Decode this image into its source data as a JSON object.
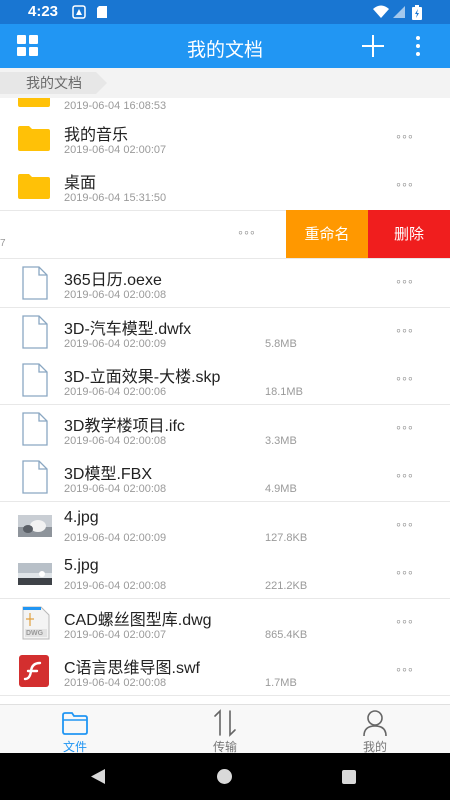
{
  "status_bar": {
    "time": "4:23",
    "icons": [
      "notification-icon",
      "sd-card-icon",
      "wifi-icon",
      "signal-icon",
      "battery-icon"
    ]
  },
  "app_bar": {
    "title": "我的文档",
    "icons": [
      "grid-menu-icon",
      "add-icon",
      "more-vert-icon"
    ]
  },
  "breadcrumb": {
    "label": "我的文档"
  },
  "partial_row": {
    "date": "2019-06-04 16:08:53"
  },
  "files": [
    {
      "type": "folder",
      "name": "我的音乐",
      "date": "2019-06-04 02:00:07",
      "size": ""
    },
    {
      "type": "folder",
      "name": "桌面",
      "date": "2019-06-04 15:31:50",
      "size": ""
    },
    {
      "type": "doc",
      "name": "365日历.oexe",
      "date": "2019-06-04 02:00:08",
      "size": ""
    },
    {
      "type": "doc",
      "name": "3D-汽车模型.dwfx",
      "date": "2019-06-04 02:00:09",
      "size": "5.8MB"
    },
    {
      "type": "doc",
      "name": "3D-立面效果-大楼.skp",
      "date": "2019-06-04 02:00:06",
      "size": "18.1MB"
    },
    {
      "type": "doc",
      "name": "3D教学楼项目.ifc",
      "date": "2019-06-04 02:00:08",
      "size": "3.3MB"
    },
    {
      "type": "doc",
      "name": "3D模型.FBX",
      "date": "2019-06-04 02:00:08",
      "size": "4.9MB"
    },
    {
      "type": "image",
      "name": "4.jpg",
      "date": "2019-06-04 02:00:09",
      "size": "127.8KB"
    },
    {
      "type": "image",
      "name": "5.jpg",
      "date": "2019-06-04 02:00:08",
      "size": "221.2KB"
    },
    {
      "type": "dwg",
      "name": "CAD螺丝图型库.dwg",
      "date": "2019-06-04 02:00:07",
      "size": "865.4KB"
    },
    {
      "type": "swf",
      "name": "C语言思维导图.swf",
      "date": "2019-06-04 02:00:08",
      "size": "1.7MB"
    }
  ],
  "row_more": "◦◦◦",
  "swipe_row": {
    "left_text": "7",
    "rename_label": "重命名",
    "delete_label": "删除"
  },
  "dwg_badge": "DWG",
  "bottom_nav": [
    {
      "label": "文件",
      "icon": "folder-icon",
      "active": true
    },
    {
      "label": "传输",
      "icon": "transfer-icon",
      "active": false
    },
    {
      "label": "我的",
      "icon": "person-icon",
      "active": false
    }
  ],
  "colors": {
    "primary": "#2196f3",
    "status_bar": "#1976d2",
    "rename": "#ff9800",
    "delete": "#f01e1e",
    "folder": "#ffc107"
  }
}
